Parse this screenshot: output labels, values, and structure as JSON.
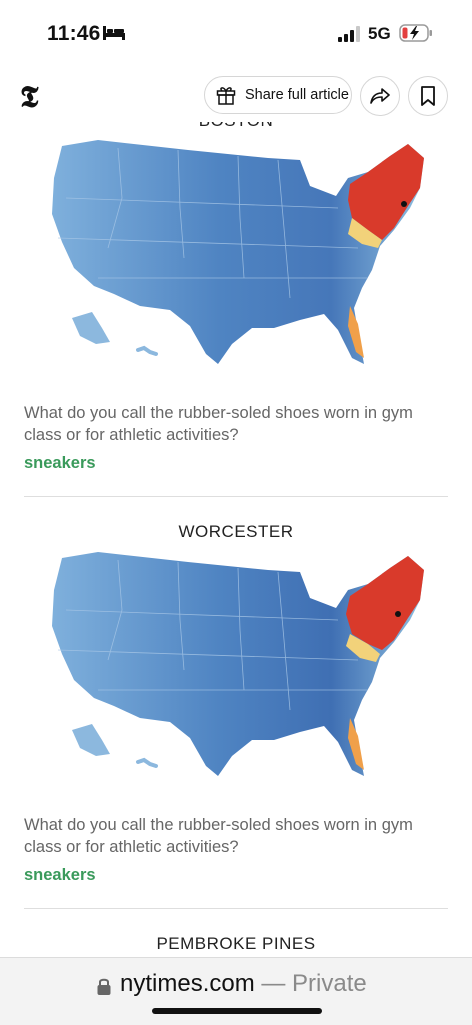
{
  "status_bar": {
    "time": "11:46",
    "network": "5G",
    "icons": [
      "bed-icon",
      "signal-icon",
      "battery-charging-icon"
    ]
  },
  "toolbar": {
    "share_label": "Share full article",
    "icons": [
      "nyt-logo",
      "gift-icon",
      "forward-arrow-icon",
      "bookmark-icon"
    ]
  },
  "article": {
    "top_partial_title": "BOSTON",
    "cards": [
      {
        "question": "What do you call the rubber-soled shoes worn in gym class or for athletic activities?",
        "answer": "sneakers"
      },
      {
        "city": "WORCESTER",
        "question": "What do you call the rubber-soled shoes worn in gym class or for athletic activities?",
        "answer": "sneakers"
      }
    ],
    "next_city": "PEMBROKE PINES"
  },
  "browser": {
    "domain": "nytimes.com",
    "separator": " — ",
    "mode": "Private"
  },
  "colors": {
    "answer_green": "#3a9a5b",
    "map_blue": "#5b8ec8",
    "map_red": "#d93a2b"
  }
}
